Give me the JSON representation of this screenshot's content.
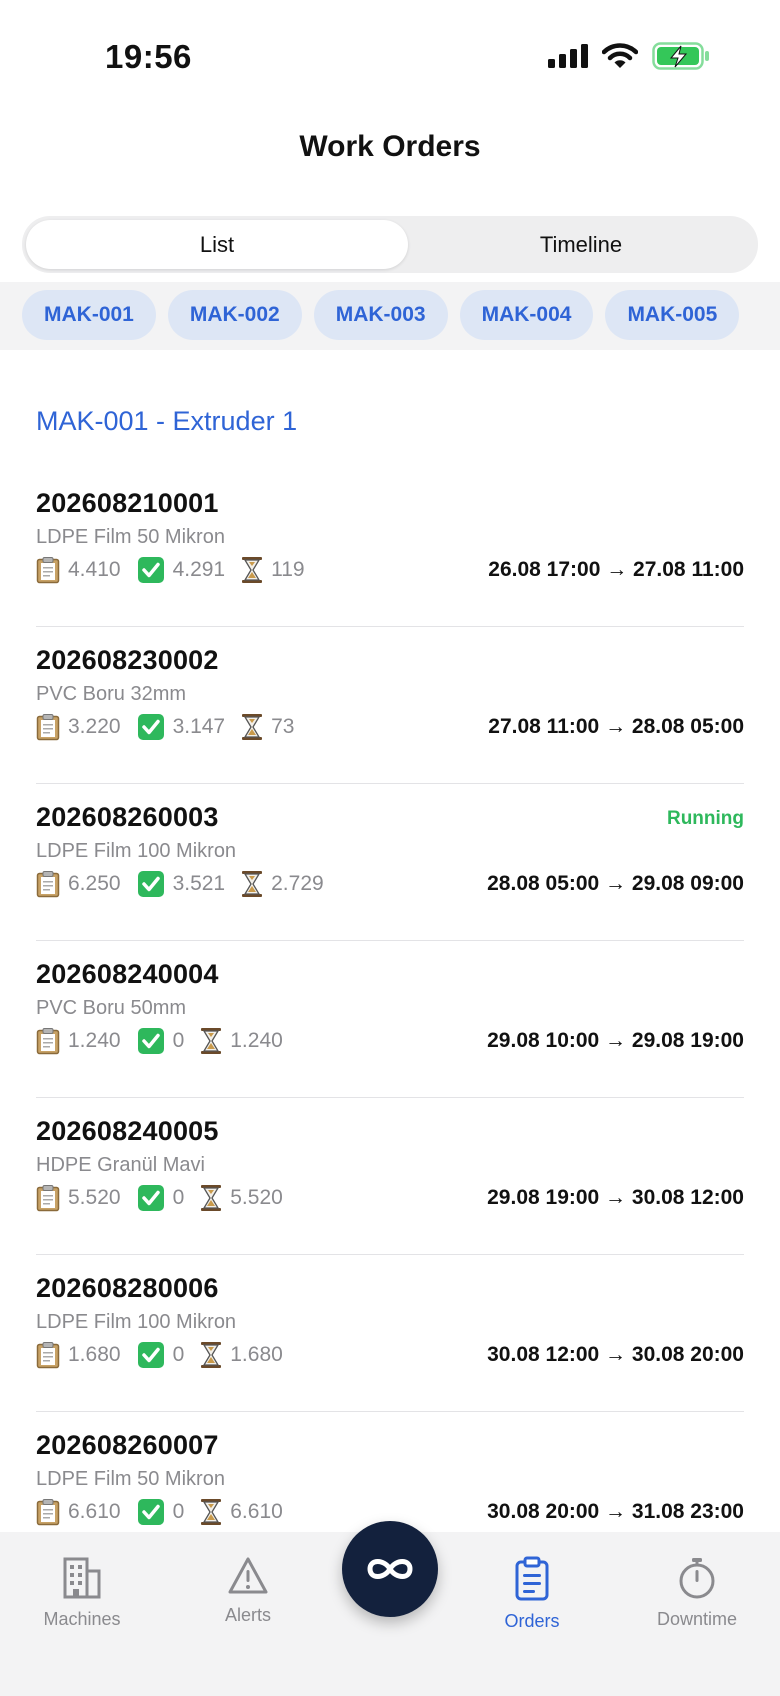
{
  "status_bar": {
    "time": "19:56"
  },
  "header": {
    "title": "Work Orders"
  },
  "segments": {
    "list": "List",
    "timeline": "Timeline"
  },
  "machines": [
    "MAK-001",
    "MAK-002",
    "MAK-003",
    "MAK-004",
    "MAK-005"
  ],
  "section": {
    "title": "MAK-001 - Extruder 1"
  },
  "orders": [
    {
      "id": "202608210001",
      "product": "LDPE Film 50 Mikron",
      "planned": "4.410",
      "done": "4.291",
      "remaining": "119",
      "range": "26.08 17:00 → 27.08 11:00",
      "status": ""
    },
    {
      "id": "202608230002",
      "product": "PVC Boru 32mm",
      "planned": "3.220",
      "done": "3.147",
      "remaining": "73",
      "range": "27.08 11:00 → 28.08 05:00",
      "status": ""
    },
    {
      "id": "202608260003",
      "product": "LDPE Film 100 Mikron",
      "planned": "6.250",
      "done": "3.521",
      "remaining": "2.729",
      "range": "28.08 05:00 → 29.08 09:00",
      "status": "Running"
    },
    {
      "id": "202608240004",
      "product": "PVC Boru 50mm",
      "planned": "1.240",
      "done": "0",
      "remaining": "1.240",
      "range": "29.08 10:00 → 29.08 19:00",
      "status": ""
    },
    {
      "id": "202608240005",
      "product": "HDPE Granül Mavi",
      "planned": "5.520",
      "done": "0",
      "remaining": "5.520",
      "range": "29.08 19:00 → 30.08 12:00",
      "status": ""
    },
    {
      "id": "202608280006",
      "product": "LDPE Film 100 Mikron",
      "planned": "1.680",
      "done": "0",
      "remaining": "1.680",
      "range": "30.08 12:00 → 30.08 20:00",
      "status": ""
    },
    {
      "id": "202608260007",
      "product": "LDPE Film 50 Mikron",
      "planned": "6.610",
      "done": "0",
      "remaining": "6.610",
      "range": "30.08 20:00 → 31.08 23:00",
      "status": ""
    }
  ],
  "tabs": {
    "machines": "Machines",
    "alerts": "Alerts",
    "orders": "Orders",
    "downtime": "Downtime"
  },
  "colors": {
    "accent": "#2f64d6",
    "running": "#2eb85c",
    "chip_bg": "#dde6f5",
    "fab": "#13213d"
  },
  "icons": {
    "planned": "clipboard-icon",
    "done": "check-box-icon",
    "remaining": "hourglass-icon"
  }
}
